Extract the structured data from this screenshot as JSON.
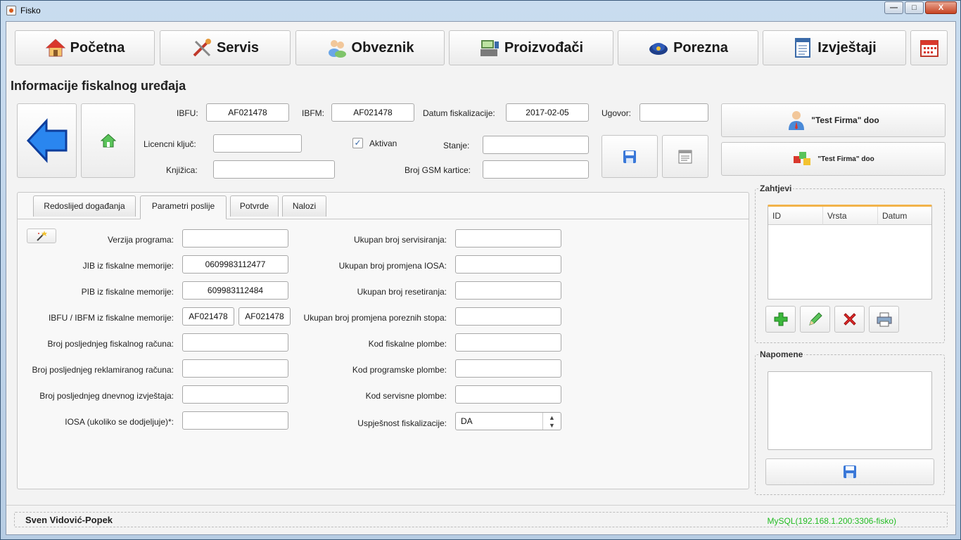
{
  "window": {
    "title": "Fisko",
    "min": "—",
    "max": "□",
    "close": "X"
  },
  "nav": {
    "pocetna": "Početna",
    "servis": "Servis",
    "obveznik": "Obveznik",
    "proizvodaci": "Proizvođači",
    "porezna": "Porezna",
    "izvjestaji": "Izvještaji"
  },
  "header": {
    "title": "Informacije fiskalnog uređaja"
  },
  "device": {
    "ibfu_label": "IBFU:",
    "ibfu": "AF021478",
    "ibfm_label": "IBFM:",
    "ibfm": "AF021478",
    "datum_label": "Datum fiskalizacije:",
    "datum": "2017-02-05",
    "ugovor_label": "Ugovor:",
    "ugovor": "",
    "licenca_label": "Licencni ključ:",
    "licenca": "",
    "aktivan_label": "Aktivan",
    "aktivan_check": "✓",
    "stanje_label": "Stanje:",
    "stanje": "",
    "knjizica_label": "Knjižica:",
    "knjizica": "",
    "gsm_label": "Broj GSM kartice:",
    "gsm": ""
  },
  "firms": {
    "obveznik": "\"Test Firma\" doo",
    "proizvodac": "\"Test Firma\" doo"
  },
  "tabs": [
    "Redoslijed događanja",
    "Parametri poslije",
    "Potvrde",
    "Nalozi"
  ],
  "params_left": [
    {
      "label": "Verzija programa:",
      "value": ""
    },
    {
      "label": "JIB iz fiskalne memorije:",
      "value": "0609983112477"
    },
    {
      "label": "PIB iz fiskalne memorije:",
      "value": "609983112484"
    },
    {
      "label": "IBFU / IBFM iz fiskalne memorije:",
      "value": "AF021478",
      "value2": "AF021478"
    },
    {
      "label": "Broj posljednjeg fiskalnog računa:",
      "value": ""
    },
    {
      "label": "Broj posljednjeg reklamiranog računa:",
      "value": ""
    },
    {
      "label": "Broj posljednjeg dnevnog izvještaja:",
      "value": ""
    },
    {
      "label": "IOSA (ukoliko se dodjeljuje)*:",
      "value": ""
    }
  ],
  "params_right": [
    {
      "label": "Ukupan broj servisiranja:",
      "value": ""
    },
    {
      "label": "Ukupan broj promjena IOSA:",
      "value": ""
    },
    {
      "label": "Ukupan broj resetiranja:",
      "value": ""
    },
    {
      "label": "Ukupan broj promjena poreznih stopa:",
      "value": ""
    },
    {
      "label": "Kod fiskalne plombe:",
      "value": ""
    },
    {
      "label": "Kod programske plombe:",
      "value": ""
    },
    {
      "label": "Kod servisne plombe:",
      "value": ""
    },
    {
      "label": "Uspješnost fiskalizacije:",
      "value": "DA"
    }
  ],
  "zahtjevi": {
    "title": "Zahtjevi",
    "columns": [
      "ID",
      "Vrsta",
      "Datum"
    ]
  },
  "napomene": {
    "title": "Napomene",
    "text": ""
  },
  "status": {
    "user": "Sven Vidović-Popek",
    "db": "MySQL(192.168.1.200:3306-fisko)"
  },
  "colors": {
    "accent": "#f2b34a",
    "db_text": "#22bb22",
    "arrow_blue": "#1e6fe0"
  }
}
